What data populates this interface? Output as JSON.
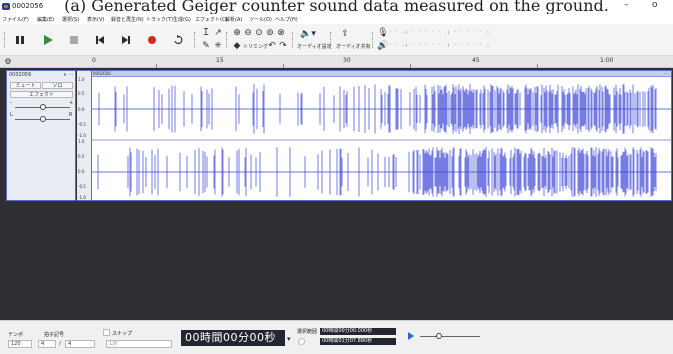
{
  "caption": "(a) Generated Geiger counter sound data measured on the ground.",
  "window": {
    "title": "0002056",
    "minimize": "–",
    "restore": "o"
  },
  "menu": [
    "ファイル(F)",
    "編集(E)",
    "選択(S)",
    "表示(V)",
    "録音と再生(N)",
    "トラック(T)",
    "生成(G)",
    "エフェクト(C)",
    "解析(A)",
    "ツール(O)",
    "ヘルプ(H)"
  ],
  "toolbar": {
    "audio_setup_label": "オーディオ設定",
    "audio_share_label": "オーディオ共有",
    "trim_label": "トリミング",
    "colors": {
      "play": "#2f8f3e",
      "record": "#d62828",
      "transport": "#2b2b2b"
    }
  },
  "ruler": {
    "labels": [
      "0",
      "15",
      "30",
      "45",
      "1:00"
    ]
  },
  "track": {
    "name": "0002056",
    "mute_label": "ミュート",
    "solo_label": "ソロ",
    "effects_label": "エフェクト",
    "gain_minus": "-",
    "gain_plus": "+",
    "pan_left": "L",
    "pan_right": "R",
    "clip_name": "0002056",
    "scale_labels": [
      "1.0",
      "0.5",
      "0.0",
      "-0.5",
      "-1.0"
    ],
    "wave_color": "#3b45d6"
  },
  "bottom": {
    "tempo_label": "テンポ",
    "time_sig_label": "拍子記号",
    "tempo_value": "120",
    "time_sig_num": "4",
    "time_sig_sep": "/",
    "time_sig_den": "4",
    "snap_label": "スナップ",
    "snap_value": "1/8",
    "time_display": "00時間00分00秒",
    "selection_label": "選択範囲",
    "sel_start": "00時間00分00.000秒",
    "sel_end": "00時間01分07.880秒"
  }
}
